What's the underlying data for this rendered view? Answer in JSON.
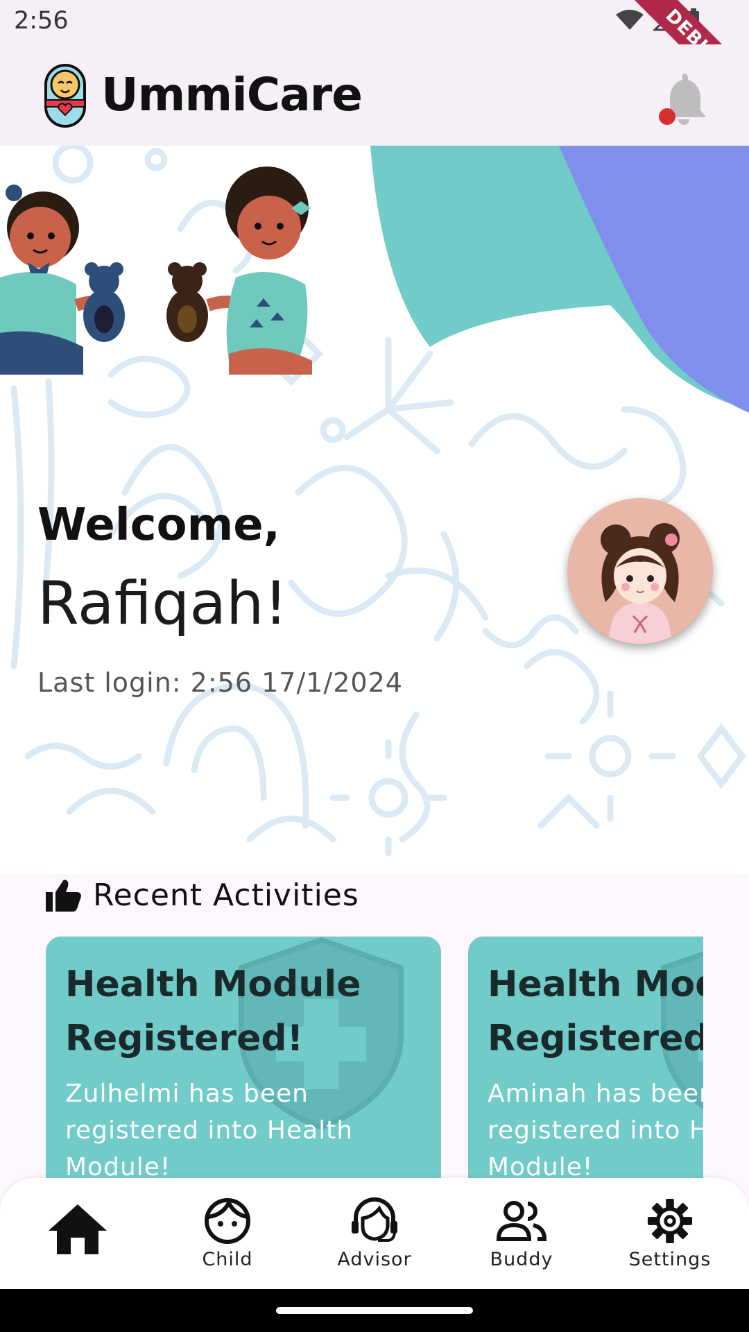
{
  "status": {
    "time": "2:56",
    "debug_label": "DEBUG"
  },
  "appbar": {
    "title": "UmmiCare"
  },
  "welcome": {
    "greeting": "Welcome,",
    "name": "Rafiqah!",
    "last_login": "Last login: 2:56 17/1/2024"
  },
  "activities": {
    "title": "Recent Activities",
    "cards": [
      {
        "title": "Health Module Registered!",
        "description": "Zulhelmi has been registered into Health Module!"
      },
      {
        "title": "Health Module Registered!",
        "description": "Aminah  has been registered into Health Module!"
      }
    ]
  },
  "nav": {
    "items": [
      {
        "label": "",
        "icon": "home-icon"
      },
      {
        "label": "Child",
        "icon": "child-face-icon"
      },
      {
        "label": "Advisor",
        "icon": "support-agent-icon"
      },
      {
        "label": "Buddy",
        "icon": "people-icon"
      },
      {
        "label": "Settings",
        "icon": "gear-icon"
      }
    ]
  },
  "colors": {
    "teal": "#70cbc9",
    "purple": "#7f8feb",
    "notification_dot": "#d32f2f"
  }
}
